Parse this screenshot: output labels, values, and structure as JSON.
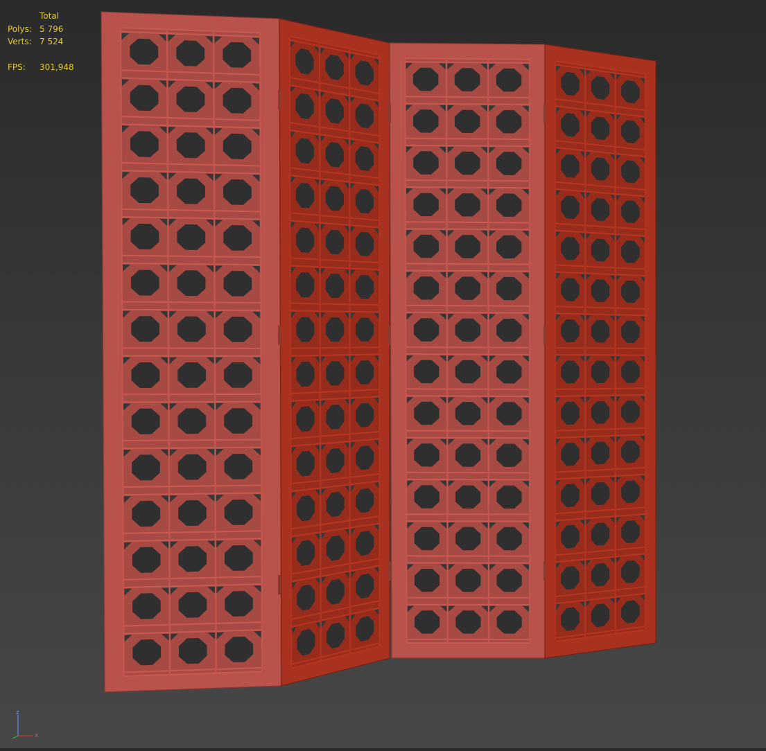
{
  "stats": {
    "header": "Total",
    "rows": [
      {
        "label": "Polys:",
        "value": "5 796"
      },
      {
        "label": "Verts:",
        "value": "7 524"
      }
    ],
    "fps_label": "FPS:",
    "fps_value": "301,948",
    "text_color": "#e6cc2e"
  },
  "axis_gizmo": {
    "z_label": "z",
    "x_label": "x"
  },
  "scene": {
    "object": "folding-screen",
    "panel_count": 4,
    "lattice": {
      "columns": 3,
      "rows": 14
    },
    "colors": {
      "panel_light": "#b8524a",
      "panel_dark": "#a8311f",
      "opening": "#2f2f2f",
      "axis_z": "#5a7bd6",
      "axis_x": "#c83030",
      "axis_y": "#2e9e3a"
    }
  }
}
